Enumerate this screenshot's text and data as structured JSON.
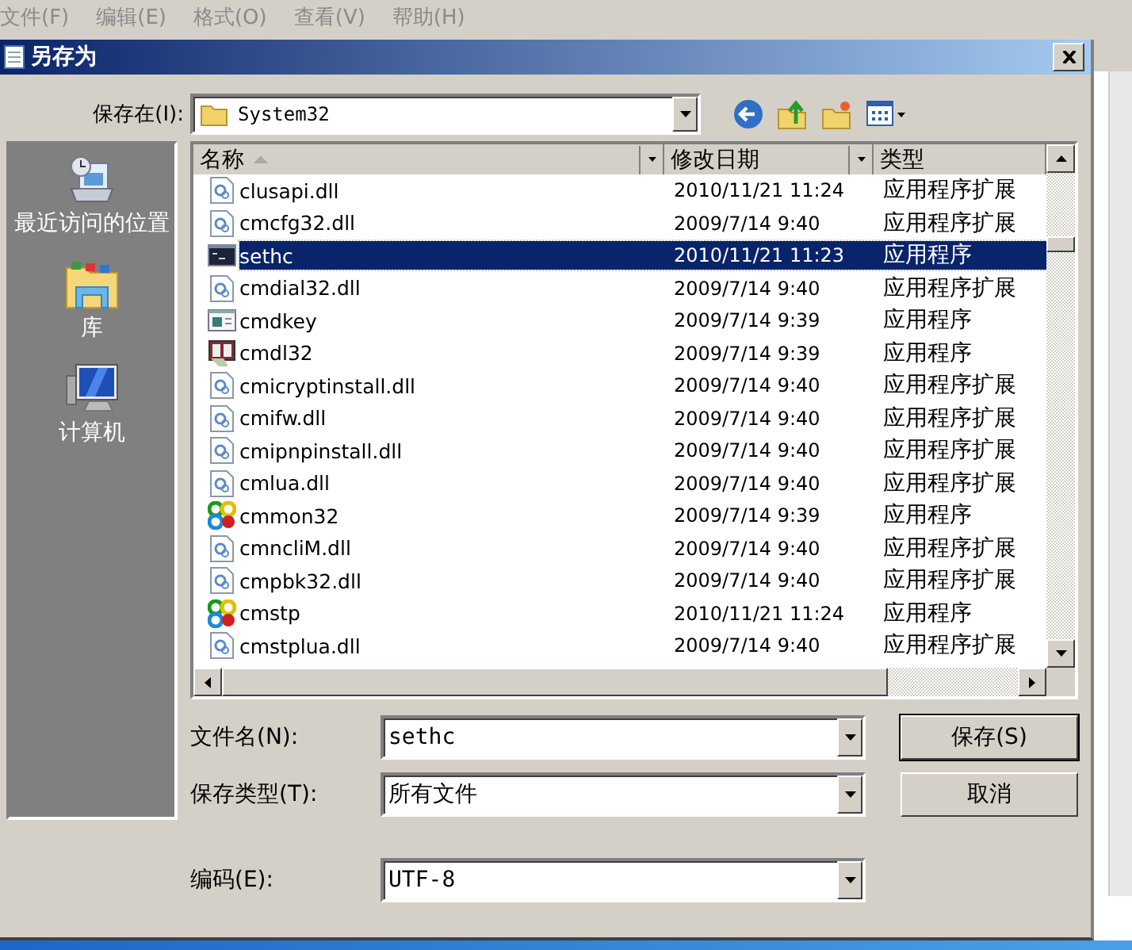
{
  "menu": [
    {
      "label": "文件(F)"
    },
    {
      "label": "编辑(E)"
    },
    {
      "label": "格式(O)"
    },
    {
      "label": "查看(V)"
    },
    {
      "label": "帮助(H)"
    }
  ],
  "dialog": {
    "title": "另存为",
    "save_in_label": "保存在(I):",
    "save_in_value": "System32"
  },
  "places": [
    {
      "label": "最近访问的位置",
      "kind": "recent"
    },
    {
      "label": "库",
      "kind": "library"
    },
    {
      "label": "计算机",
      "kind": "computer"
    }
  ],
  "file_list": {
    "columns": [
      "名称",
      "修改日期",
      "类型"
    ],
    "rows": [
      {
        "name": "clusapi.dll",
        "date": "2010/11/21 11:24",
        "type": "应用程序扩展",
        "kind": "dll",
        "selected": false
      },
      {
        "name": "cmcfg32.dll",
        "date": "2009/7/14 9:40",
        "type": "应用程序扩展",
        "kind": "dll",
        "selected": false
      },
      {
        "name": "sethc",
        "date": "2010/11/21 11:23",
        "type": "应用程序",
        "kind": "console",
        "selected": true
      },
      {
        "name": "cmdial32.dll",
        "date": "2009/7/14 9:40",
        "type": "应用程序扩展",
        "kind": "dll",
        "selected": false
      },
      {
        "name": "cmdkey",
        "date": "2009/7/14 9:39",
        "type": "应用程序",
        "kind": "window",
        "selected": false
      },
      {
        "name": "cmdl32",
        "date": "2009/7/14 9:39",
        "type": "应用程序",
        "kind": "book",
        "selected": false
      },
      {
        "name": "cmicryptinstall.dll",
        "date": "2009/7/14 9:40",
        "type": "应用程序扩展",
        "kind": "dll",
        "selected": false
      },
      {
        "name": "cmifw.dll",
        "date": "2009/7/14 9:40",
        "type": "应用程序扩展",
        "kind": "dll",
        "selected": false
      },
      {
        "name": "cmipnpinstall.dll",
        "date": "2009/7/14 9:40",
        "type": "应用程序扩展",
        "kind": "dll",
        "selected": false
      },
      {
        "name": "cmlua.dll",
        "date": "2009/7/14 9:40",
        "type": "应用程序扩展",
        "kind": "dll",
        "selected": false
      },
      {
        "name": "cmmon32",
        "date": "2009/7/14 9:39",
        "type": "应用程序",
        "kind": "colorful",
        "selected": false
      },
      {
        "name": "cmncliM.dll",
        "date": "2009/7/14 9:40",
        "type": "应用程序扩展",
        "kind": "dll",
        "selected": false
      },
      {
        "name": "cmpbk32.dll",
        "date": "2009/7/14 9:40",
        "type": "应用程序扩展",
        "kind": "dll",
        "selected": false
      },
      {
        "name": "cmstp",
        "date": "2010/11/21 11:24",
        "type": "应用程序",
        "kind": "colorful",
        "selected": false
      },
      {
        "name": "cmstplua.dll",
        "date": "2009/7/14 9:40",
        "type": "应用程序扩展",
        "kind": "dll",
        "selected": false
      }
    ]
  },
  "fields": [
    {
      "label": "文件名(N):",
      "value": "sethc",
      "button": {
        "label": "保存(S)",
        "default": true
      }
    },
    {
      "label": "保存类型(T):",
      "value": "所有文件",
      "button": {
        "label": "取消",
        "default": false
      }
    },
    {
      "label": "编码(E):",
      "value": "UTF-8"
    }
  ]
}
